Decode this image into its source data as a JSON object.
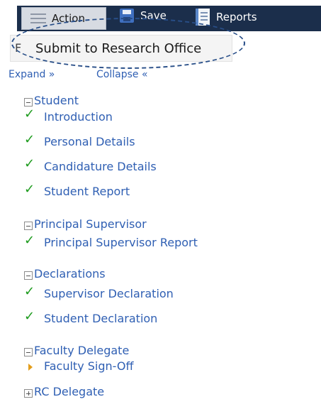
{
  "toolbar": {
    "action_label": "Action",
    "save_label": "Save",
    "reports_label": "Reports"
  },
  "menu": {
    "submit_label": "Submit to Research Office",
    "left_char": "F"
  },
  "links": {
    "expand": "Expand »",
    "collapse": "Collapse «"
  },
  "tree": {
    "student": {
      "label": "Student",
      "items": [
        "Introduction",
        "Personal Details",
        "Candidature Details",
        "Student Report"
      ]
    },
    "principal_supervisor": {
      "label": "Principal Supervisor",
      "items": [
        "Principal Supervisor Report"
      ]
    },
    "declarations": {
      "label": "Declarations",
      "items": [
        "Supervisor Declaration",
        "Student Declaration"
      ]
    },
    "faculty_delegate": {
      "label": "Faculty Delegate",
      "items": [
        "Faculty Sign-Off"
      ]
    },
    "rc_delegate": {
      "label": "RC Delegate"
    }
  },
  "colors": {
    "toolbar_bg": "#1b2e4b",
    "link_blue": "#2f5fb3",
    "check_green": "#1d9b1d",
    "arrow_orange": "#e39d1a",
    "annotation_dashed": "#284e88"
  }
}
